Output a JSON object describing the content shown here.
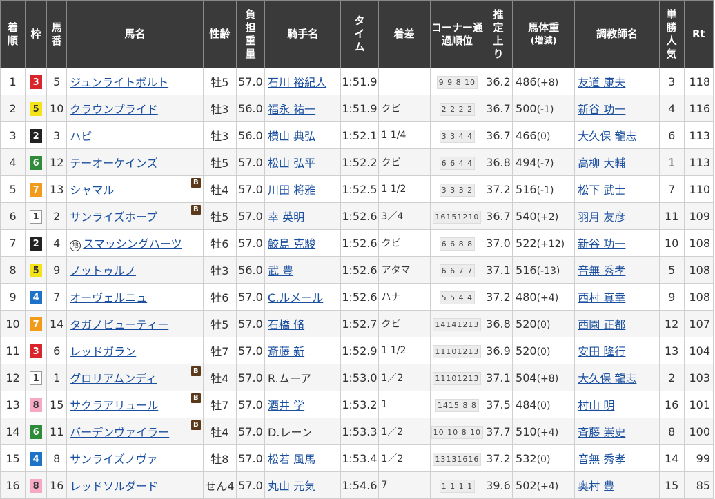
{
  "headers": {
    "rank": "着順",
    "waku": "枠",
    "umaban": "馬番",
    "horse": "馬名",
    "sexage": "性齢",
    "weight_carried": "負担重量",
    "jockey": "騎手名",
    "time": "タイム",
    "margin": "着差",
    "corner": "コーナー通過順位",
    "last3f": "推定上り",
    "body_weight": "馬体重",
    "body_weight_sub": "(増減)",
    "trainer": "調教師名",
    "popularity": "単勝人気",
    "rt": "Rt"
  },
  "colors": {
    "header_bg": "#3a3a3a",
    "link": "#1a4fa0",
    "blinker_bg": "#5a3a1a",
    "waku1": "#ffffff",
    "waku2": "#222222",
    "waku3": "#d9262c",
    "waku4": "#1e73c8",
    "waku5": "#f5e31a",
    "waku6": "#2e8b3a",
    "waku7": "#f29b1a",
    "waku8": "#f5a9c4"
  },
  "blinker_mark": "B",
  "local_mark": "地",
  "rows": [
    {
      "rank": "1",
      "waku": "3",
      "umaban": "5",
      "horse": "ジュンライトボルト",
      "blinker": false,
      "local": false,
      "sexage": "牡5",
      "kg": "57.0",
      "jockey": "石川 裕紀人",
      "jockey_link": true,
      "time": "1:51.9",
      "margin": "",
      "corner": "9 9 8 10",
      "last3f": "36.2",
      "bw": "486",
      "bwd": "(+8)",
      "trainer": "友道 康夫",
      "pop": "3",
      "rt": "118"
    },
    {
      "rank": "2",
      "waku": "5",
      "umaban": "10",
      "horse": "クラウンプライド",
      "blinker": false,
      "local": false,
      "sexage": "牡3",
      "kg": "56.0",
      "jockey": "福永 祐一",
      "jockey_link": true,
      "time": "1:51.9",
      "margin": "クビ",
      "corner": "2 2 2 2",
      "last3f": "36.7",
      "bw": "500",
      "bwd": "(-1)",
      "trainer": "新谷 功一",
      "pop": "4",
      "rt": "116"
    },
    {
      "rank": "3",
      "waku": "2",
      "umaban": "3",
      "horse": "ハピ",
      "blinker": false,
      "local": false,
      "sexage": "牡3",
      "kg": "56.0",
      "jockey": "横山 典弘",
      "jockey_link": true,
      "time": "1:52.1",
      "margin": "1 1/4",
      "corner": "3 3 4 4",
      "last3f": "36.7",
      "bw": "466",
      "bwd": "(0)",
      "trainer": "大久保 龍志",
      "pop": "6",
      "rt": "113"
    },
    {
      "rank": "4",
      "waku": "6",
      "umaban": "12",
      "horse": "テーオーケインズ",
      "blinker": false,
      "local": false,
      "sexage": "牡5",
      "kg": "57.0",
      "jockey": "松山 弘平",
      "jockey_link": true,
      "time": "1:52.2",
      "margin": "クビ",
      "corner": "6 6 4 4",
      "last3f": "36.8",
      "bw": "494",
      "bwd": "(-7)",
      "trainer": "高柳 大輔",
      "pop": "1",
      "rt": "113"
    },
    {
      "rank": "5",
      "waku": "7",
      "umaban": "13",
      "horse": "シャマル",
      "blinker": true,
      "local": false,
      "sexage": "牡4",
      "kg": "57.0",
      "jockey": "川田 将雅",
      "jockey_link": true,
      "time": "1:52.5",
      "margin": "1 1/2",
      "corner": "3 3 3 2",
      "last3f": "37.2",
      "bw": "516",
      "bwd": "(-1)",
      "trainer": "松下 武士",
      "pop": "7",
      "rt": "110"
    },
    {
      "rank": "6",
      "waku": "1",
      "umaban": "2",
      "horse": "サンライズホープ",
      "blinker": true,
      "local": false,
      "sexage": "牡5",
      "kg": "57.0",
      "jockey": "幸 英明",
      "jockey_link": true,
      "time": "1:52.6",
      "margin": "3／4",
      "corner": "16151210",
      "last3f": "36.7",
      "bw": "540",
      "bwd": "(+2)",
      "trainer": "羽月 友彦",
      "pop": "11",
      "rt": "109"
    },
    {
      "rank": "7",
      "waku": "2",
      "umaban": "4",
      "horse": "スマッシングハーツ",
      "blinker": false,
      "local": true,
      "sexage": "牡6",
      "kg": "57.0",
      "jockey": "鮫島 克駿",
      "jockey_link": true,
      "time": "1:52.6",
      "margin": "クビ",
      "corner": "6 6 8 8",
      "last3f": "37.0",
      "bw": "522",
      "bwd": "(+12)",
      "trainer": "新谷 功一",
      "pop": "10",
      "rt": "108"
    },
    {
      "rank": "8",
      "waku": "5",
      "umaban": "9",
      "horse": "ノットゥルノ",
      "blinker": false,
      "local": false,
      "sexage": "牡3",
      "kg": "56.0",
      "jockey": "武 豊",
      "jockey_link": true,
      "time": "1:52.6",
      "margin": "アタマ",
      "corner": "6 6 7 7",
      "last3f": "37.1",
      "bw": "516",
      "bwd": "(-13)",
      "trainer": "音無 秀孝",
      "pop": "5",
      "rt": "108"
    },
    {
      "rank": "9",
      "waku": "4",
      "umaban": "7",
      "horse": "オーヴェルニュ",
      "blinker": false,
      "local": false,
      "sexage": "牡6",
      "kg": "57.0",
      "jockey": "C.ルメール",
      "jockey_link": true,
      "time": "1:52.6",
      "margin": "ハナ",
      "corner": "5 5 4 4",
      "last3f": "37.2",
      "bw": "480",
      "bwd": "(+4)",
      "trainer": "西村 真幸",
      "pop": "9",
      "rt": "108"
    },
    {
      "rank": "10",
      "waku": "7",
      "umaban": "14",
      "horse": "タガノビューティー",
      "blinker": false,
      "local": false,
      "sexage": "牡5",
      "kg": "57.0",
      "jockey": "石橋 脩",
      "jockey_link": true,
      "time": "1:52.7",
      "margin": "クビ",
      "corner": "14141213",
      "last3f": "36.8",
      "bw": "520",
      "bwd": "(0)",
      "trainer": "西園 正都",
      "pop": "12",
      "rt": "107"
    },
    {
      "rank": "11",
      "waku": "3",
      "umaban": "6",
      "horse": "レッドガラン",
      "blinker": false,
      "local": false,
      "sexage": "牡7",
      "kg": "57.0",
      "jockey": "斎藤 新",
      "jockey_link": true,
      "time": "1:52.9",
      "margin": "1 1/2",
      "corner": "11101213",
      "last3f": "36.9",
      "bw": "520",
      "bwd": "(0)",
      "trainer": "安田 隆行",
      "pop": "13",
      "rt": "104"
    },
    {
      "rank": "12",
      "waku": "1",
      "umaban": "1",
      "horse": "グロリアムンディ",
      "blinker": true,
      "local": false,
      "sexage": "牡4",
      "kg": "57.0",
      "jockey": "R.ムーア",
      "jockey_link": false,
      "time": "1:53.0",
      "margin": "1／2",
      "corner": "11101213",
      "last3f": "37.1",
      "bw": "504",
      "bwd": "(+8)",
      "trainer": "大久保 龍志",
      "pop": "2",
      "rt": "103"
    },
    {
      "rank": "13",
      "waku": "8",
      "umaban": "15",
      "horse": "サクラアリュール",
      "blinker": true,
      "local": false,
      "sexage": "牡7",
      "kg": "57.0",
      "jockey": "酒井 学",
      "jockey_link": true,
      "time": "1:53.2",
      "margin": "1",
      "corner": "1415 8 8",
      "last3f": "37.5",
      "bw": "484",
      "bwd": "(0)",
      "trainer": "村山 明",
      "pop": "16",
      "rt": "101"
    },
    {
      "rank": "14",
      "waku": "6",
      "umaban": "11",
      "horse": "バーデンヴァイラー",
      "blinker": true,
      "local": false,
      "sexage": "牡4",
      "kg": "57.0",
      "jockey": "D.レーン",
      "jockey_link": false,
      "time": "1:53.3",
      "margin": "1／2",
      "corner": "10 10 8 10",
      "last3f": "37.7",
      "bw": "510",
      "bwd": "(+4)",
      "trainer": "斉藤 崇史",
      "pop": "8",
      "rt": "100"
    },
    {
      "rank": "15",
      "waku": "4",
      "umaban": "8",
      "horse": "サンライズノヴァ",
      "blinker": false,
      "local": false,
      "sexage": "牡8",
      "kg": "57.0",
      "jockey": "松若 風馬",
      "jockey_link": true,
      "time": "1:53.4",
      "margin": "1／2",
      "corner": "13131616",
      "last3f": "37.2",
      "bw": "532",
      "bwd": "(0)",
      "trainer": "音無 秀孝",
      "pop": "14",
      "rt": "99"
    },
    {
      "rank": "16",
      "waku": "8",
      "umaban": "16",
      "horse": "レッドソルダード",
      "blinker": false,
      "local": false,
      "sexage": "せん4",
      "kg": "57.0",
      "jockey": "丸山 元気",
      "jockey_link": true,
      "time": "1:54.6",
      "margin": "7",
      "corner": "1 1 1 1",
      "last3f": "39.6",
      "bw": "502",
      "bwd": "(+4)",
      "trainer": "奥村 豊",
      "pop": "15",
      "rt": "85"
    }
  ]
}
